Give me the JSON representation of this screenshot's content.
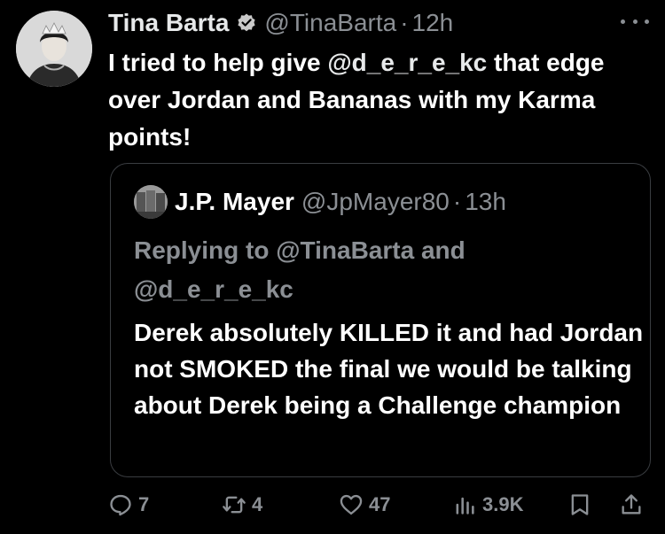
{
  "tweet": {
    "display_name": "Tina Barta",
    "handle": "@TinaBarta",
    "separator": "·",
    "time": "12h",
    "text_part1": "I tried to help give ",
    "mention": "@d_e_r_e_kc",
    "text_part2": " that edge over Jordan and Bananas with my Karma points!"
  },
  "quote": {
    "display_name": "J.P. Mayer",
    "handle": "@JpMayer80",
    "separator": "·",
    "time": "13h",
    "replying_to": "Replying to @TinaBarta and @d_e_r_e_kc",
    "text": "Derek absolutely KILLED it and had Jordan not SMOKED the final we would be talking about Derek being a Challenge champion"
  },
  "actions": {
    "reply_count": "7",
    "retweet_count": "4",
    "like_count": "47",
    "view_count": "3.9K"
  },
  "icons": {
    "verified": "verified-badge-icon",
    "more": "more-icon",
    "reply": "reply-icon",
    "retweet": "retweet-icon",
    "like": "heart-icon",
    "views": "views-chart-icon",
    "bookmark": "bookmark-icon",
    "share": "share-icon"
  },
  "colors": {
    "background": "#000000",
    "text": "#ffffff",
    "muted": "#8b8f94",
    "border": "#3a3d41"
  }
}
